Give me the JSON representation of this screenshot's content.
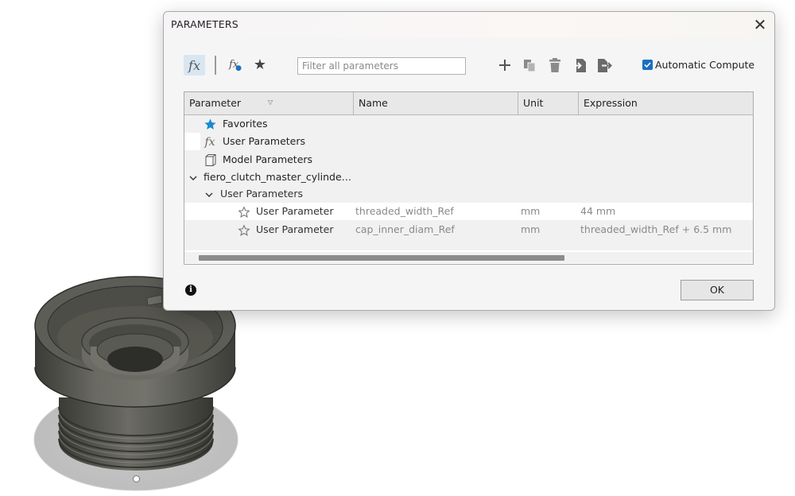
{
  "dialog": {
    "title": "PARAMETERS",
    "close_glyph": "✕"
  },
  "toolbar": {
    "fx_label": "fx",
    "fx_user_label": "fx",
    "favorite_glyph": "★",
    "search_placeholder": "Filter all parameters",
    "icons": [
      "add-icon",
      "copy-icon",
      "delete-icon",
      "import-icon",
      "export-icon"
    ],
    "auto_compute_label": "Automatic Compute",
    "auto_compute_checked": true
  },
  "table": {
    "columns": [
      "Parameter",
      "Name",
      "Unit",
      "Expression"
    ],
    "groups": {
      "favorites": "Favorites",
      "user_parameters": "User Parameters",
      "model_parameters": "Model Parameters",
      "document": "fiero_clutch_master_cylinde…",
      "doc_user_parameters": "User Parameters"
    },
    "rows": [
      {
        "parameter": "User Parameter",
        "name": "threaded_width_Ref",
        "unit": "mm",
        "expression": "44 mm"
      },
      {
        "parameter": "User Parameter",
        "name": "cap_inner_diam_Ref",
        "unit": "mm",
        "expression": "threaded_width_Ref + 6.5 mm"
      }
    ]
  },
  "footer": {
    "info_glyph": "i",
    "ok_label": "OK"
  },
  "colors": {
    "accent": "#1a6fc2",
    "star_blue": "#1a8ad4"
  }
}
